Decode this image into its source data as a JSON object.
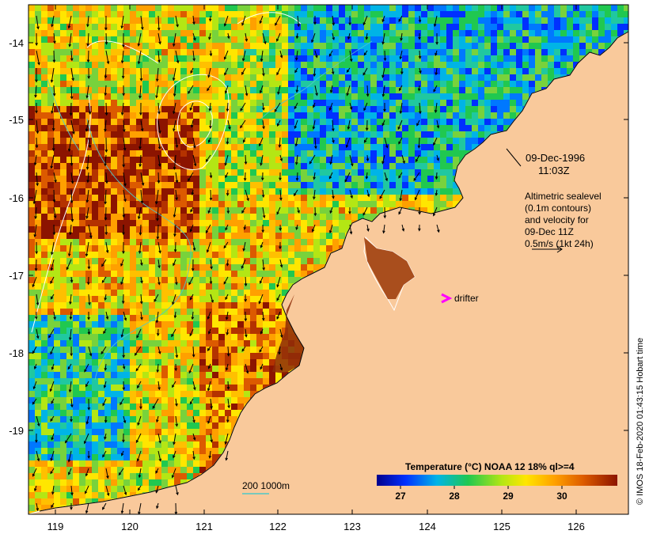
{
  "map": {
    "date_label": "09-Dec-1996",
    "time_label": "11:03Z",
    "altimetry_lines": [
      "Altimetric sealevel",
      "(0.1m contours)",
      "and velocity for",
      "09-Dec 11Z",
      "0.5m/s (1kt 24h)"
    ],
    "drifter_label": "drifter",
    "depth_contour_label": "200  1000m",
    "credit": "© IMOS 18-Feb-2020 01:43:15 Hobart time",
    "legend": {
      "title": "Temperature (°C) NOAA 12 18% ql>=4",
      "ticks": [
        "27",
        "28",
        "29",
        "30"
      ]
    },
    "axes": {
      "x_ticks": [
        "119",
        "120",
        "121",
        "122",
        "123",
        "124",
        "125",
        "126"
      ],
      "y_ticks": [
        "-14",
        "-15",
        "-16",
        "-17",
        "-18",
        "-19"
      ]
    },
    "colors": {
      "land": "#f9c99b",
      "drifter": "#ff00ff",
      "contour": "#ffffff",
      "isobath": "#4fc8c8"
    }
  }
}
